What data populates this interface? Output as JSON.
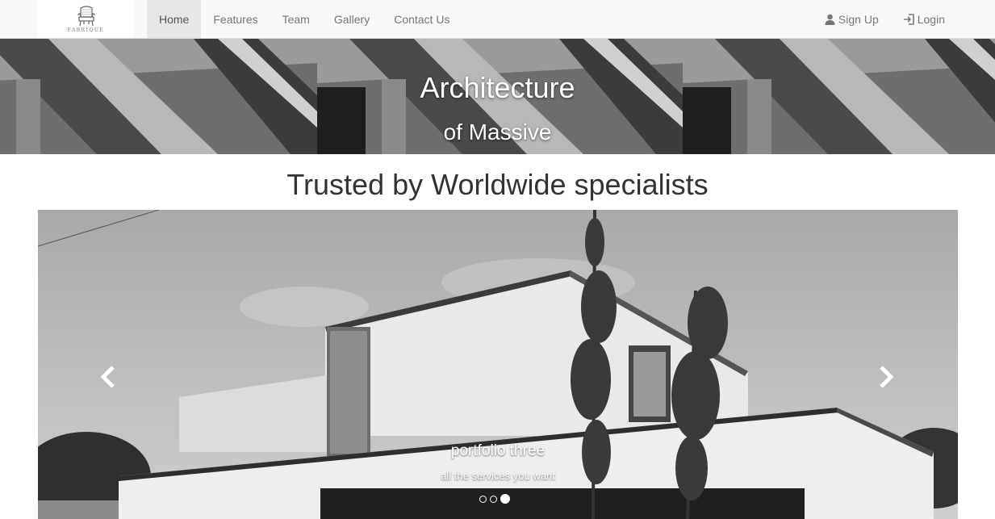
{
  "brand": {
    "name": "FABRIQUE",
    "logo_icon": "armchair-logo"
  },
  "nav": {
    "items": [
      {
        "label": "Home",
        "active": true
      },
      {
        "label": "Features"
      },
      {
        "label": "Team"
      },
      {
        "label": "Gallery"
      },
      {
        "label": "Contact Us"
      }
    ],
    "right": [
      {
        "label": "Sign Up",
        "icon": "user-icon"
      },
      {
        "label": "Login",
        "icon": "login-icon"
      }
    ]
  },
  "hero": {
    "title": "Architecture",
    "subtitle": "of Massive"
  },
  "section": {
    "title": "Trusted by Worldwide specialists"
  },
  "carousel": {
    "caption_title": "portfolio three",
    "caption_text": "all the services you want",
    "slide_count": 3,
    "active_slide": 3,
    "prev_icon": "chevron-left-icon",
    "next_icon": "chevron-right-icon"
  },
  "colors": {
    "navbar_bg": "#f8f8f8",
    "active_nav_bg": "#e7e7e7",
    "nav_text": "#777777"
  }
}
